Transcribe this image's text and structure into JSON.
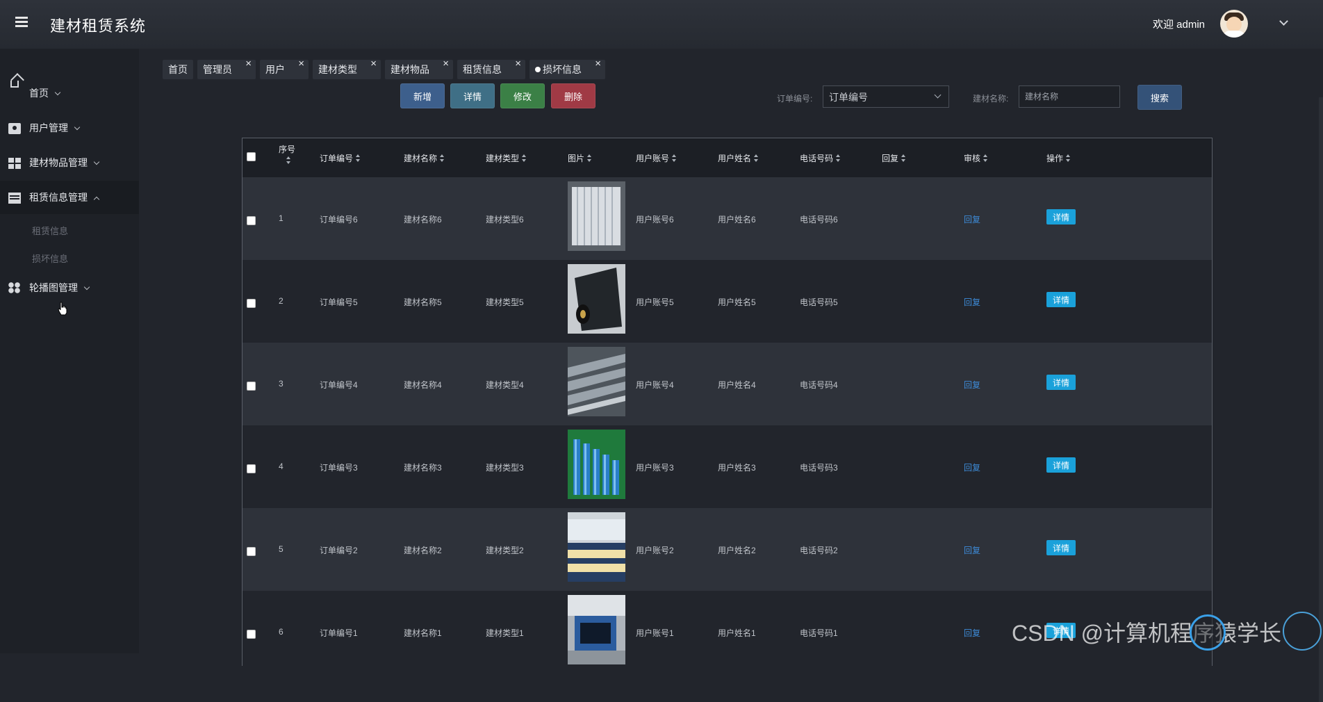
{
  "app": {
    "title": "建材租赁系统"
  },
  "user": {
    "welcome": "欢迎 admin"
  },
  "sidebar": {
    "items": [
      {
        "label": "首页",
        "icon": "home-icon"
      },
      {
        "label": "用户管理",
        "icon": "id-card-icon"
      },
      {
        "label": "建材物品管理",
        "icon": "grid-icon"
      },
      {
        "label": "租赁信息管理",
        "icon": "list-icon",
        "expanded": true,
        "children": [
          "租赁信息",
          "损坏信息"
        ]
      },
      {
        "label": "轮播图管理",
        "icon": "dots-icon"
      }
    ]
  },
  "tabs": [
    "首页",
    "管理员",
    "用户",
    "建材类型",
    "建材物品",
    "租赁信息",
    "损坏信息"
  ],
  "toolbar": {
    "new_label": "新增",
    "detail_label": "详情",
    "edit_label": "修改",
    "delete_label": "删除"
  },
  "filters": {
    "order_label": "订单编号:",
    "order_value": "订单编号",
    "name_label": "建材名称:",
    "name_placeholder": "建材名称",
    "search_label": "搜索"
  },
  "table": {
    "headers": [
      "序号",
      "订单编号",
      "建材名称",
      "建材类型",
      "图片",
      "用户账号",
      "用户姓名",
      "电话号码",
      "回复",
      "审核",
      "操作"
    ],
    "rows": [
      {
        "index": "1",
        "order": "订单编号6",
        "name": "建材名称6",
        "type": "建材类型6",
        "account": "用户账号6",
        "username": "用户姓名6",
        "phone": "电话号码6",
        "audit": "回复",
        "action": "详情",
        "image": "white-panels"
      },
      {
        "index": "2",
        "order": "订单编号5",
        "name": "建材名称5",
        "type": "建材类型5",
        "account": "用户账号5",
        "username": "用户姓名5",
        "phone": "电话号码5",
        "audit": "回复",
        "action": "详情",
        "image": "black-roll"
      },
      {
        "index": "3",
        "order": "订单编号4",
        "name": "建材名称4",
        "type": "建材类型4",
        "account": "用户账号4",
        "username": "用户姓名4",
        "phone": "电话号码4",
        "audit": "回复",
        "action": "详情",
        "image": "grey-sheets"
      },
      {
        "index": "4",
        "order": "订单编号3",
        "name": "建材名称3",
        "type": "建材类型3",
        "account": "用户账号3",
        "username": "用户姓名3",
        "phone": "电话号码3",
        "audit": "回复",
        "action": "详情",
        "image": "blue-rolls"
      },
      {
        "index": "5",
        "order": "订单编号2",
        "name": "建材名称2",
        "type": "建材类型2",
        "account": "用户账号2",
        "username": "用户姓名2",
        "phone": "电话号码2",
        "audit": "回复",
        "action": "详情",
        "image": "sandwich-panels"
      },
      {
        "index": "6",
        "order": "订单编号1",
        "name": "建材名称1",
        "type": "建材类型1",
        "account": "用户账号1",
        "username": "用户姓名1",
        "phone": "电话号码1",
        "audit": "回复",
        "action": "详情",
        "image": "factory-line"
      }
    ]
  },
  "watermark": "CSDN @计算机程序猿学长",
  "colors": {
    "new": "#3d5f8c",
    "detail": "#3f6f86",
    "edit": "#3b8046",
    "delete": "#a03a45",
    "search": "#345278",
    "link": "#3d8bd8",
    "detail_row": "#1aa1da"
  }
}
